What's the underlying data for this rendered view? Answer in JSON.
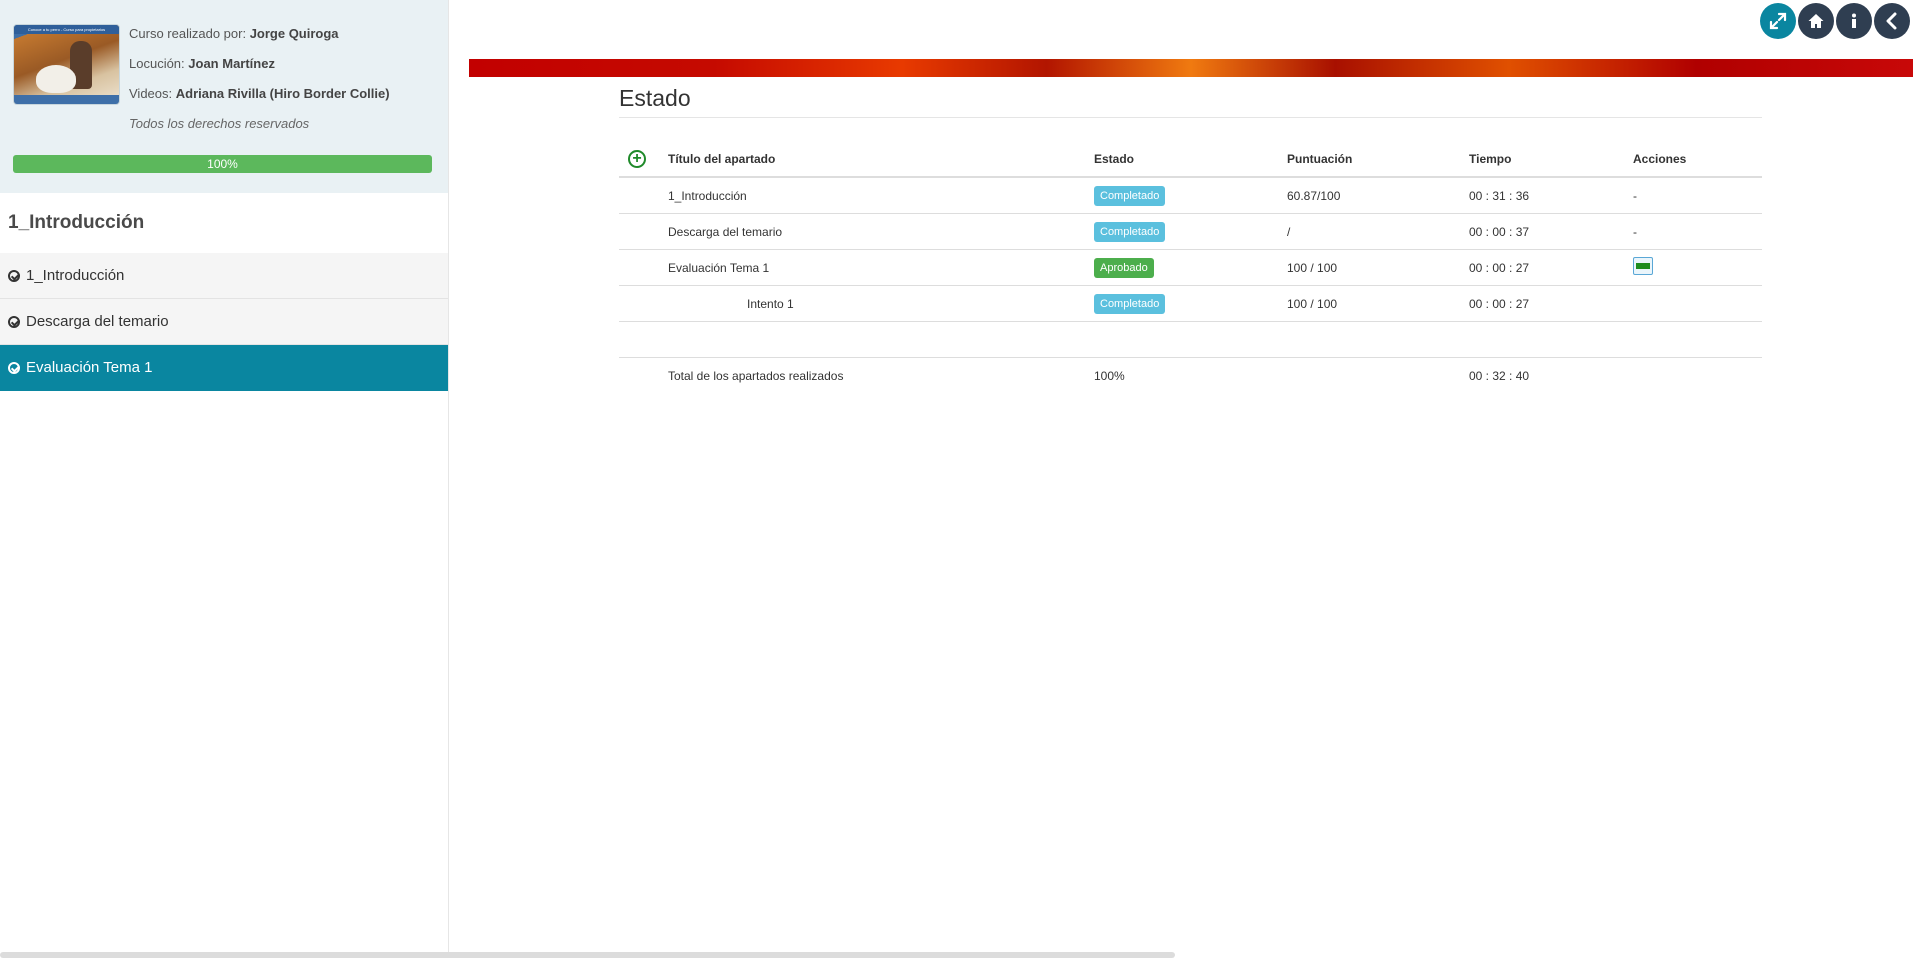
{
  "sidebar": {
    "credits": {
      "course_by_label": "Curso realizado por:",
      "course_by_name": "Jorge Quiroga",
      "voice_label": "Locución:",
      "voice_name": "Joan Martínez",
      "videos_label": "Videos:",
      "videos_name": "Adriana Rivilla (Hiro Border Collie)",
      "rights": "Todos los derechos reservados"
    },
    "thumbnail_alt": "Conoce a tu perro - Curso para propietarios",
    "progress": {
      "value": 100,
      "label": "100%"
    },
    "module_title": "1_Introducción",
    "items": [
      {
        "label": "1_Introducción",
        "active": false
      },
      {
        "label": "Descarga del temario",
        "active": false
      },
      {
        "label": "Evaluación Tema 1",
        "active": true
      }
    ]
  },
  "top_buttons": [
    {
      "icon": "expand-icon",
      "color": "#0a86a0"
    },
    {
      "icon": "home-icon",
      "color": "#2f3e51"
    },
    {
      "icon": "info-icon",
      "color": "#2f3e51"
    },
    {
      "icon": "chevron-left-icon",
      "color": "#2f3e51"
    }
  ],
  "content": {
    "title": "Estado",
    "table": {
      "headers": {
        "title": "Título del apartado",
        "status": "Estado",
        "score": "Puntuación",
        "time": "Tiempo",
        "actions": "Acciones"
      },
      "rows": [
        {
          "title": "1_Introducción",
          "status": "Completado",
          "score": "60.87/100",
          "time": "00 : 31 : 36",
          "actions": "-"
        },
        {
          "title": "Descarga del temario",
          "status": "Completado",
          "score": "/",
          "time": "00 : 00 : 37",
          "actions": "-"
        },
        {
          "title": "Evaluación Tema 1",
          "status": "Aprobado",
          "score": "100 / 100",
          "time": "00 : 00 : 27",
          "actions": ""
        },
        {
          "title": "Intento 1",
          "status": "Completado",
          "score": "100 / 100",
          "time": "00 : 00 : 27",
          "actions": ""
        }
      ],
      "total": {
        "label": "Total de los apartados realizados",
        "progress": "100%",
        "time": "00 : 32 : 40"
      }
    }
  },
  "colors": {
    "accent": "#0a86a0",
    "dark": "#2f3e51",
    "progress": "#5cb85c",
    "info": "#5bc0de",
    "success": "#4cae4c"
  }
}
